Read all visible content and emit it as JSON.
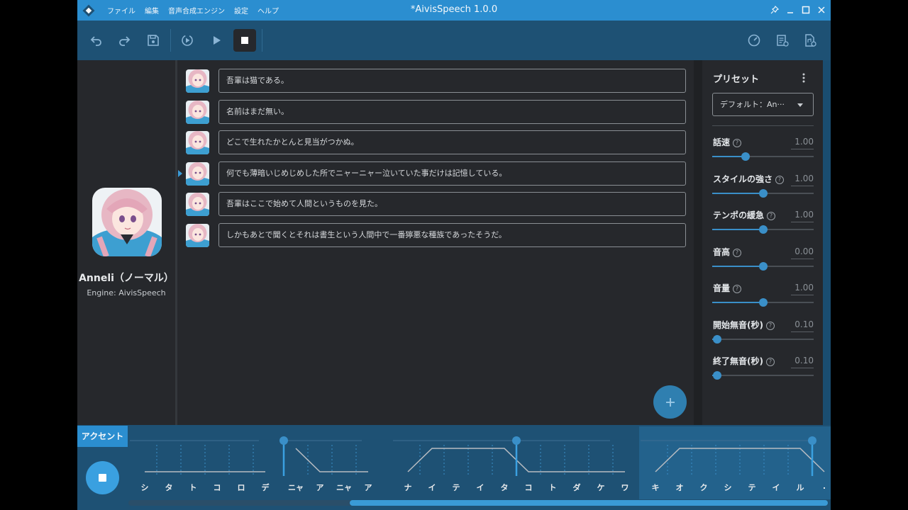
{
  "title_bar": {
    "menu": [
      "ファイル",
      "編集",
      "音声合成エンジン",
      "設定",
      "ヘルプ"
    ],
    "title": "*AivisSpeech 1.0.0"
  },
  "character": {
    "name": "Anneli（ノーマル）",
    "engine": "Engine: AivisSpeech"
  },
  "lines": [
    {
      "text": "吾輩は猫である。",
      "active": false
    },
    {
      "text": "名前はまだ無い。",
      "active": false
    },
    {
      "text": "どこで生れたかとんと見当がつかぬ。",
      "active": false
    },
    {
      "text": "何でも薄暗いじめじめした所でニャーニャー泣いていた事だけは記憶している。",
      "active": true
    },
    {
      "text": "吾輩はここで始めて人間というものを見た。",
      "active": false
    },
    {
      "text": "しかもあとで聞くとそれは書生という人間中で一番獰悪な種族であったそうだ。",
      "active": false
    }
  ],
  "preset": {
    "title": "プリセット",
    "selected": "デフォルト：An···"
  },
  "params": [
    {
      "label": "話速",
      "value": "1.00",
      "level": 0.33
    },
    {
      "label": "スタイルの強さ",
      "value": "1.00",
      "level": 0.5
    },
    {
      "label": "テンポの緩急",
      "value": "1.00",
      "level": 0.5
    },
    {
      "label": "音高",
      "value": "0.00",
      "level": 0.5
    },
    {
      "label": "音量",
      "value": "1.00",
      "level": 0.5
    },
    {
      "label": "開始無音(秒)",
      "value": "0.10",
      "level": 0.05
    },
    {
      "label": "終了無音(秒)",
      "value": "0.10",
      "level": 0.05
    }
  ],
  "accent": {
    "tab_label": "アクセント",
    "groups": [
      {
        "moras": [
          "シ",
          "タ",
          "ト",
          "コ",
          "ロ",
          "デ"
        ],
        "accent": 0
      },
      {
        "moras": [
          "ニャ",
          "ア",
          "ニャ",
          "ア"
        ],
        "accent": 1
      },
      {
        "moras": [
          "ナ",
          "イ",
          "テ",
          "イ",
          "タ",
          "コ",
          "ト",
          "ダ",
          "ケ",
          "ワ"
        ],
        "accent": 5
      },
      {
        "moras": [
          "キ",
          "オ",
          "ク",
          "シ",
          "テ",
          "イ",
          "ル",
          "."
        ],
        "accent": 7
      }
    ]
  },
  "colors": {
    "accent_blue": "#2b8ed0",
    "toolbar": "#1e5174",
    "background": "#26282c"
  }
}
